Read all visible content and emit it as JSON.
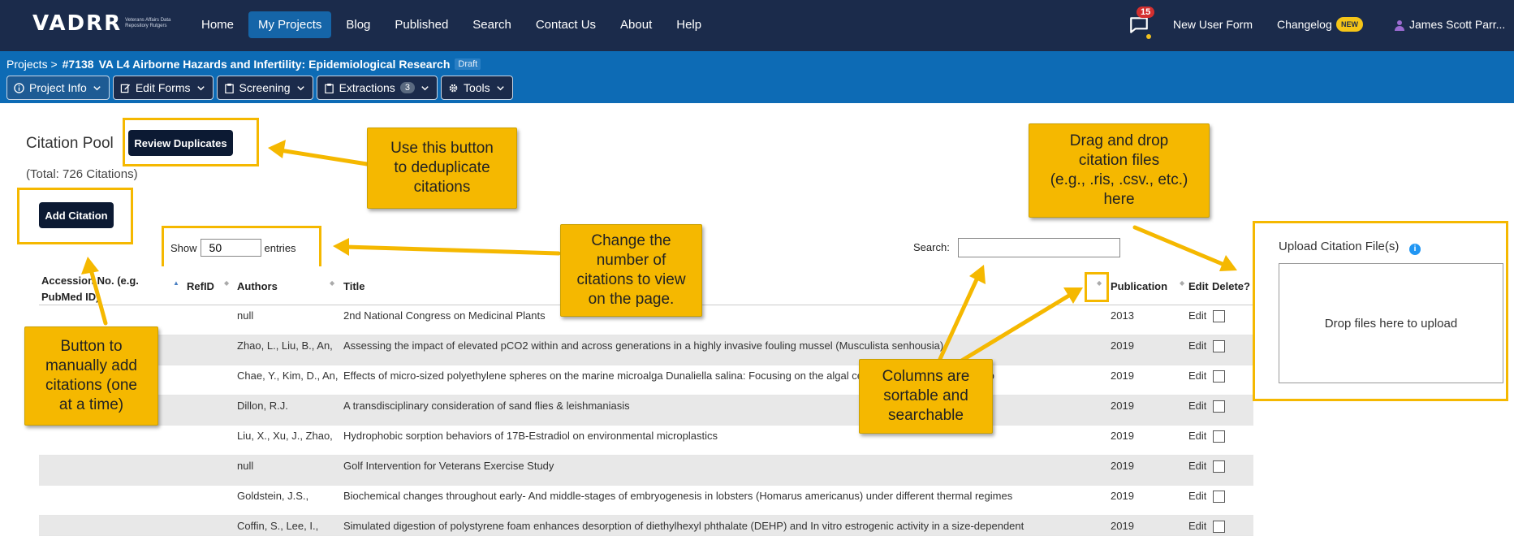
{
  "header": {
    "logo": "VADRR",
    "logo_subtitle": "Veterans Affairs Data Repository Rutgers",
    "nav": [
      "Home",
      "My Projects",
      "Blog",
      "Published",
      "Search",
      "Contact Us",
      "About",
      "Help"
    ],
    "active_nav": "My Projects",
    "notification_count": "15",
    "new_user_form": "New User Form",
    "changelog": "Changelog",
    "changelog_badge": "NEW",
    "user_name": "James Scott Parr..."
  },
  "project": {
    "breadcrumb_root": "Projects >",
    "project_id": "#7138",
    "project_name": "VA L4 Airborne Hazards and Infertility: Epidemiological Research",
    "status": "Draft",
    "tabs": [
      {
        "label": "Project Info",
        "icon": "info-icon"
      },
      {
        "label": "Edit Forms",
        "icon": "edit-icon"
      },
      {
        "label": "Screening",
        "icon": "clipboard-icon"
      },
      {
        "label": "Extractions",
        "icon": "clipboard-icon",
        "count": "3"
      },
      {
        "label": "Tools",
        "icon": "gear-icon"
      }
    ]
  },
  "citations": {
    "title": "Citation Pool",
    "review_duplicates": "Review Duplicates",
    "total": "(Total: 726 Citations)",
    "add_citation": "Add Citation",
    "show_label": "Show",
    "show_value": "50",
    "entries_label": "entries",
    "search_label": "Search:",
    "columns": [
      "Accession No. (e.g. PubMed ID)",
      "RefID",
      "Authors",
      "Title",
      "Publication",
      "Edit",
      "Delete?"
    ],
    "rows": [
      {
        "authors": "null",
        "title": "2nd National Congress on Medicinal Plants",
        "year": "2013",
        "edit": "Edit"
      },
      {
        "authors": "Zhao, L., Liu, B., An,",
        "title": "Assessing the impact of elevated pCO2 within and across generations in a highly invasive fouling mussel (Musculista senhousia)",
        "year": "2019",
        "edit": "Edit"
      },
      {
        "authors": "Chae, Y., Kim, D., An,",
        "title": "Effects of micro-sized polyethylene spheres on the marine microalga Dunaliella salina: Focusing on the algal cell to plastic particle size ratio",
        "year": "2019",
        "edit": "Edit"
      },
      {
        "authors": "Dillon, R.J.",
        "title": "A transdisciplinary consideration of sand flies & leishmaniasis",
        "year": "2019",
        "edit": "Edit"
      },
      {
        "authors": "Liu, X., Xu, J., Zhao,",
        "title": "Hydrophobic sorption behaviors of 17B-Estradiol on environmental microplastics",
        "year": "2019",
        "edit": "Edit"
      },
      {
        "authors": "null",
        "title": "Golf Intervention for Veterans Exercise Study",
        "year": "2019",
        "edit": "Edit"
      },
      {
        "authors": "Goldstein, J.S.,",
        "title": "Biochemical changes throughout early- And middle-stages of embryogenesis in lobsters (Homarus americanus) under different thermal regimes",
        "year": "2019",
        "edit": "Edit"
      },
      {
        "authors": "Coffin, S., Lee, I.,",
        "title": "Simulated digestion of polystyrene foam enhances desorption of diethylhexyl phthalate (DEHP) and In vitro estrogenic activity in a size-dependent",
        "year": "2019",
        "edit": "Edit"
      }
    ]
  },
  "upload": {
    "label": "Upload Citation File(s)",
    "drop_text": "Drop files here to upload"
  },
  "callouts": {
    "dedupe": "Use this button\nto deduplicate\ncitations",
    "entries": "Change the\nnumber of\ncitations to view\non the page.",
    "drag_drop": "Drag and drop\ncitation files\n(e.g., .ris, .csv., etc.)\nhere",
    "add_manual": "Button to\nmanually add\ncitations (one\nat a time)",
    "sortable": "Columns are\nsortable and\nsearchable"
  },
  "colors": {
    "header": "#1b2b4b",
    "project_bar": "#0d6bb5",
    "highlight": "#f5b800"
  }
}
